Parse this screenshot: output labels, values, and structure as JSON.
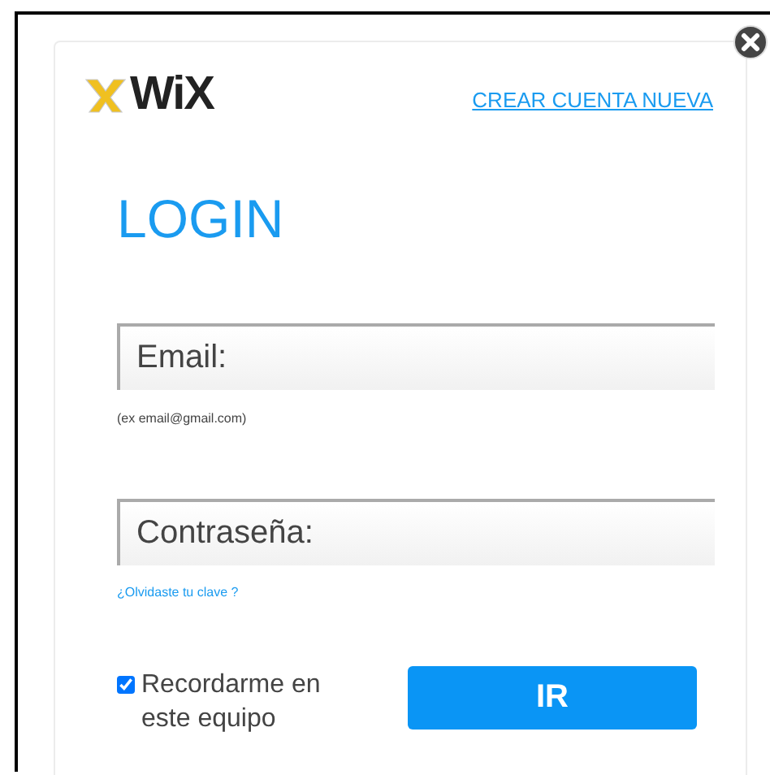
{
  "logo": {
    "text": "WiX"
  },
  "create_account_link": "CREAR CUENTA NUEVA",
  "title": "LOGIN",
  "email": {
    "placeholder": "Email:",
    "hint": "(ex email@gmail.com)"
  },
  "password": {
    "placeholder": "Contraseña:",
    "forgot_link": "¿Olvidaste tu clave ?"
  },
  "remember": {
    "label": "Recordarme en este equipo",
    "checked": true
  },
  "submit_button": "IR"
}
